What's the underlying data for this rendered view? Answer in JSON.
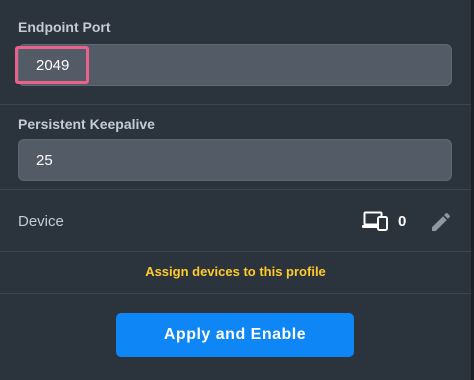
{
  "endpoint_port": {
    "label": "Endpoint Port",
    "value": "2049"
  },
  "persistent_keepalive": {
    "label": "Persistent Keepalive",
    "value": "25"
  },
  "device": {
    "label": "Device",
    "count": "0",
    "icon": "devices-icon",
    "edit_icon": "pencil-icon"
  },
  "assign_link": {
    "label": "Assign devices to this profile"
  },
  "apply_button": {
    "label": "Apply and Enable"
  },
  "colors": {
    "background": "#2b333d",
    "input_background": "#535c66",
    "highlight": "#e8628b",
    "link": "#ffcb2b",
    "button": "#0e86f5"
  }
}
